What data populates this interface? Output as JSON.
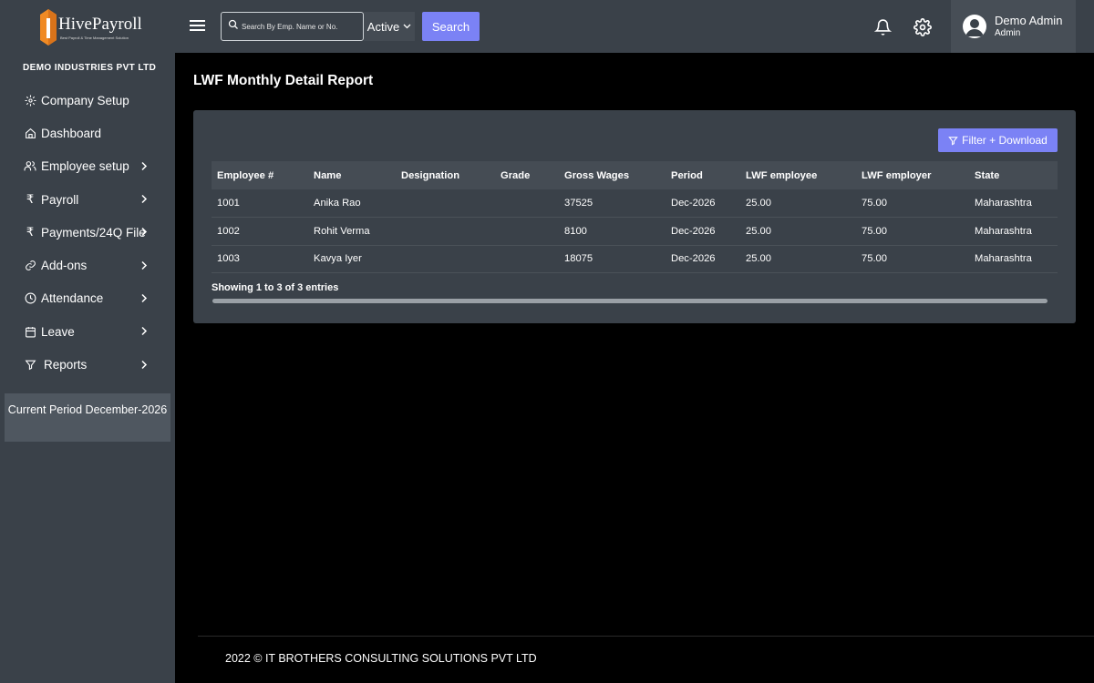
{
  "brand": {
    "name": "HivePayroll",
    "tagline": "Best Payroll & Time Management Solution"
  },
  "company": "DEMO INDUSTRIES PVT LTD",
  "sidebar": {
    "items": [
      {
        "label": "Company Setup",
        "icon": "gear-icon",
        "has_submenu": false
      },
      {
        "label": "Dashboard",
        "icon": "home-icon",
        "has_submenu": false
      },
      {
        "label": "Employee setup",
        "icon": "users-icon",
        "has_submenu": true
      },
      {
        "label": "Payroll",
        "icon": "rupee-icon",
        "has_submenu": true
      },
      {
        "label": "Payments/24Q File",
        "icon": "rupee-icon",
        "has_submenu": true
      },
      {
        "label": "Add-ons",
        "icon": "link-icon",
        "has_submenu": true
      },
      {
        "label": "Attendance",
        "icon": "clock-icon",
        "has_submenu": true
      },
      {
        "label": "Leave",
        "icon": "calendar-icon",
        "has_submenu": true
      },
      {
        "label": "Reports",
        "icon": "filter-icon",
        "has_submenu": true
      }
    ],
    "period_label": "Current Period December-2026"
  },
  "header": {
    "search_placeholder": "Search By Emp. Name or No.",
    "status_value": "Active",
    "search_button": "Search",
    "user_name": "Demo Admin",
    "user_role": "Admin"
  },
  "page": {
    "title": "LWF Monthly Detail Report",
    "filter_button": "Filter + Download",
    "table": {
      "columns": [
        "Employee #",
        "Name",
        "Designation",
        "Grade",
        "Gross Wages",
        "Period",
        "LWF employee",
        "LWF employer",
        "State"
      ],
      "rows": [
        [
          "1001",
          "Anika Rao",
          "",
          "",
          "37525",
          "Dec-2026",
          "25.00",
          "75.00",
          "Maharashtra"
        ],
        [
          "1002",
          "Rohit Verma",
          "",
          "",
          "8100",
          "Dec-2026",
          "25.00",
          "75.00",
          "Maharashtra"
        ],
        [
          "1003",
          "Kavya Iyer",
          "",
          "",
          "18075",
          "Dec-2026",
          "25.00",
          "75.00",
          "Maharashtra"
        ]
      ]
    },
    "entries_info": "Showing 1 to 3 of 3 entries"
  },
  "footer": "2022 © IT BROTHERS CONSULTING SOLUTIONS PVT LTD",
  "colors": {
    "sidebar_bg": "#3a4149",
    "accent": "#7b82f5",
    "logo_orange": "#f08a24"
  }
}
